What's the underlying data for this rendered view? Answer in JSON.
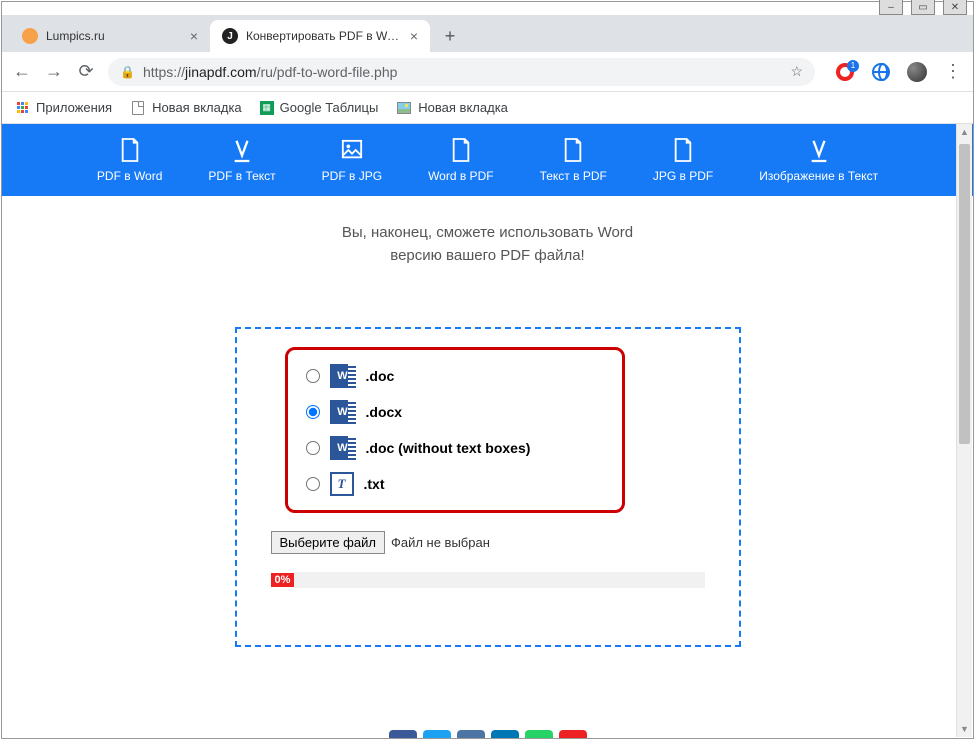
{
  "window": {
    "minimize": "–",
    "maximize": "▭",
    "close": "✕"
  },
  "tabs": [
    {
      "title": "Lumpics.ru",
      "active": false,
      "favicon": "#f7a14a"
    },
    {
      "title": "Конвертировать PDF в Word - P",
      "active": true,
      "favicon": "#222"
    }
  ],
  "addressbar": {
    "scheme": "https://",
    "host": "jinapdf.com",
    "path": "/ru/pdf-to-word-file.php"
  },
  "opera_badge": "1",
  "bookmarks": [
    {
      "icon": "apps",
      "label": "Приложения"
    },
    {
      "icon": "page",
      "label": "Новая вкладка"
    },
    {
      "icon": "sheet",
      "label": "Google Таблицы"
    },
    {
      "icon": "img",
      "label": "Новая вкладка"
    }
  ],
  "tools": [
    {
      "label": "PDF в Word"
    },
    {
      "label": "PDF в Текст"
    },
    {
      "label": "PDF в JPG"
    },
    {
      "label": "Word в PDF"
    },
    {
      "label": "Текст в PDF"
    },
    {
      "label": "JPG в PDF"
    },
    {
      "label": "Изображение в Текст"
    }
  ],
  "subtitle_line1": "Вы, наконец, сможете использовать Word",
  "subtitle_line2": "версию вашего PDF файла!",
  "options": [
    {
      "label": ".doc",
      "icon": "word",
      "selected": false
    },
    {
      "label": ".docx",
      "icon": "word",
      "selected": true
    },
    {
      "label": ".doc (without text boxes)",
      "icon": "word",
      "selected": false
    },
    {
      "label": ".txt",
      "icon": "txt",
      "selected": false
    }
  ],
  "choose_file_button": "Выберите файл",
  "file_status": "Файл не выбран",
  "progress_pct": "0%",
  "social_colors": [
    "#3b5998",
    "#1da1f2",
    "#4c75a3",
    "#0077b5",
    "#25d366",
    "#e22"
  ]
}
